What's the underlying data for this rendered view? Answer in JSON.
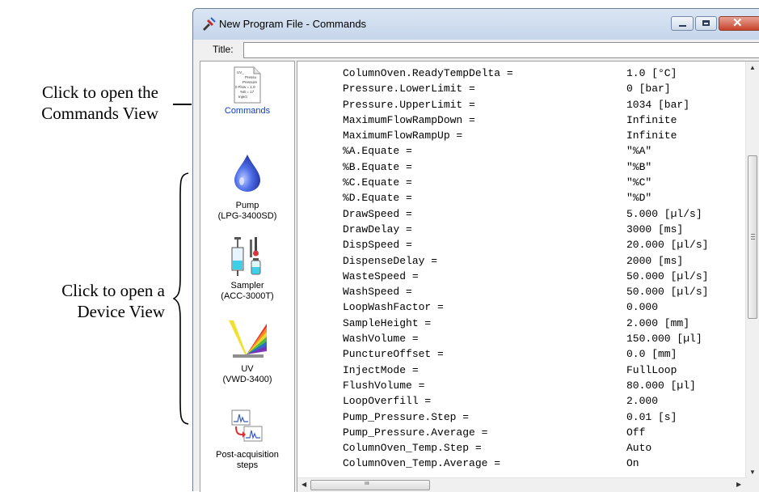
{
  "annotations": {
    "commands_view": [
      "Click to open the",
      "Commands View"
    ],
    "device_view": [
      "Click to open a",
      "Device View"
    ]
  },
  "window": {
    "title": "New Program File - Commands",
    "title_label": "Title:",
    "title_value": ""
  },
  "nav": {
    "commands": {
      "label": "Commands",
      "icon_text": [
        "UV_",
        "Pressu",
        "Pressure",
        "0 Flow = 1.0",
        "%B = 17",
        "Inject"
      ]
    },
    "pump": {
      "label": "Pump",
      "sub": "(LPG-3400SD)"
    },
    "sampler": {
      "label": "Sampler",
      "sub": "(ACC-3000T)"
    },
    "uv": {
      "label": "UV",
      "sub": "(VWD-3400)"
    },
    "post": {
      "label": "Post-acquisition",
      "sub": "steps"
    }
  },
  "commands": [
    {
      "key": "ColumnOven.ReadyTempDelta =",
      "value": "1.0 [°C]"
    },
    {
      "key": "Pressure.LowerLimit =",
      "value": "0 [bar]"
    },
    {
      "key": "Pressure.UpperLimit =",
      "value": "1034 [bar]"
    },
    {
      "key": "MaximumFlowRampDown =",
      "value": "Infinite"
    },
    {
      "key": "MaximumFlowRampUp =",
      "value": "Infinite"
    },
    {
      "key": "%A.Equate =",
      "value": "\"%A\""
    },
    {
      "key": "%B.Equate =",
      "value": "\"%B\""
    },
    {
      "key": "%C.Equate =",
      "value": "\"%C\""
    },
    {
      "key": "%D.Equate =",
      "value": "\"%D\""
    },
    {
      "key": "DrawSpeed =",
      "value": "5.000 [µl/s]"
    },
    {
      "key": "DrawDelay =",
      "value": "3000 [ms]"
    },
    {
      "key": "DispSpeed =",
      "value": "20.000 [µl/s]"
    },
    {
      "key": "DispenseDelay =",
      "value": "2000 [ms]"
    },
    {
      "key": "WasteSpeed =",
      "value": "50.000 [µl/s]"
    },
    {
      "key": "WashSpeed =",
      "value": "50.000 [µl/s]"
    },
    {
      "key": "LoopWashFactor =",
      "value": "0.000"
    },
    {
      "key": "SampleHeight =",
      "value": "2.000 [mm]"
    },
    {
      "key": "WashVolume =",
      "value": "150.000 [µl]"
    },
    {
      "key": "PunctureOffset =",
      "value": "0.0 [mm]"
    },
    {
      "key": "InjectMode =",
      "value": "FullLoop"
    },
    {
      "key": "FlushVolume =",
      "value": "80.000 [µl]"
    },
    {
      "key": "LoopOverfill =",
      "value": "2.000"
    },
    {
      "key": "Pump_Pressure.Step =",
      "value": "0.01 [s]"
    },
    {
      "key": "Pump_Pressure.Average =",
      "value": "Off"
    },
    {
      "key": "ColumnOven_Temp.Step =",
      "value": "Auto"
    },
    {
      "key": "ColumnOven_Temp.Average =",
      "value": "On"
    }
  ],
  "scroll": {
    "vertical_position": 0.23,
    "horizontal_position": 0.0
  }
}
